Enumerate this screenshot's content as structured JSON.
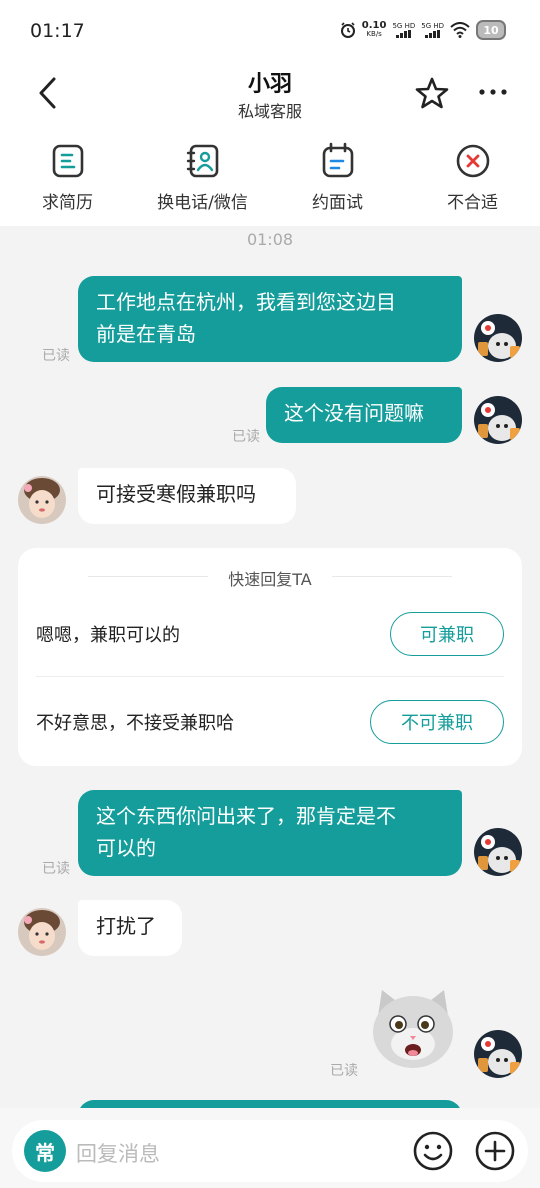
{
  "status_bar": {
    "time": "01:17",
    "net_speed_value": "0.10",
    "net_speed_unit": "KB/s",
    "signal1": "5G HD",
    "signal2": "5G HD",
    "battery": "10"
  },
  "header": {
    "title": "小羽",
    "subtitle": "私域客服",
    "icons": [
      "back-arrow-icon",
      "star-icon",
      "more-icon"
    ]
  },
  "actions": [
    {
      "label": "求简历",
      "icon": "resume-icon"
    },
    {
      "label": "换电话/微信",
      "icon": "contact-card-icon"
    },
    {
      "label": "约面试",
      "icon": "calendar-icon"
    },
    {
      "label": "不合适",
      "icon": "reject-icon"
    }
  ],
  "chat": {
    "timestamp": "01:08",
    "messages": [
      {
        "side": "out",
        "text_line1": "工作地点在杭州，我看到您这边目",
        "text_line2": "前是在青岛",
        "status": "已读"
      },
      {
        "side": "out",
        "text": "这个没有问题嘛",
        "status": "已读"
      },
      {
        "side": "in",
        "text": "可接受寒假兼职吗"
      },
      {
        "side": "out",
        "text_line1": "这个东西你问出来了，那肯定是不",
        "text_line2": "可以的",
        "status": "已读"
      },
      {
        "side": "in",
        "text": "打扰了"
      },
      {
        "side": "out",
        "sticker": "cat-sticker",
        "status": "已读"
      }
    ]
  },
  "quick_reply": {
    "title": "快速回复TA",
    "options": [
      {
        "text": "嗯嗯，兼职可以的",
        "button": "可兼职"
      },
      {
        "text": "不好意思，不接受兼职哈",
        "button": "不可兼职"
      }
    ]
  },
  "input": {
    "common_label": "常",
    "placeholder": "回复消息",
    "icons": [
      "emoji-icon",
      "plus-icon"
    ]
  },
  "colors": {
    "accent": "#159d9b",
    "background": "#f3f3f3"
  }
}
